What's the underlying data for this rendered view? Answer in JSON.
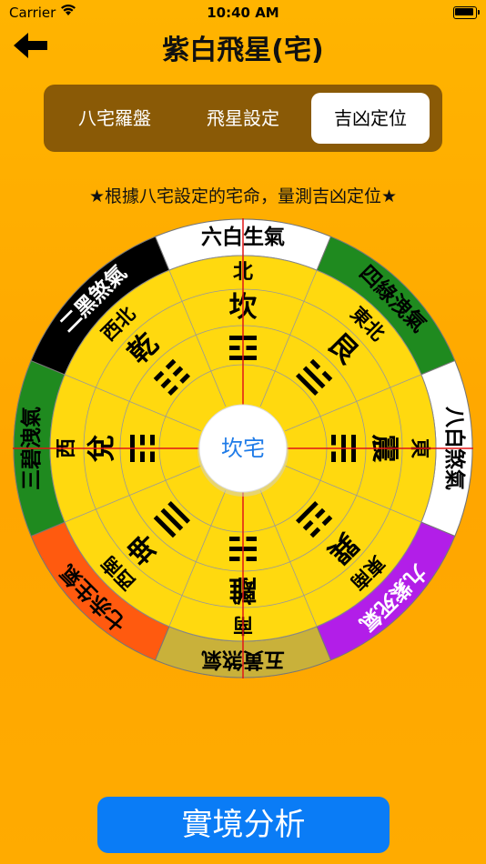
{
  "status_bar": {
    "carrier": "Carrier",
    "time": "10:40 AM"
  },
  "nav": {
    "title": "紫白飛星(宅)",
    "back_icon": "back-arrow-icon"
  },
  "tabs": [
    {
      "label": "八宅羅盤",
      "active": false
    },
    {
      "label": "飛星設定",
      "active": false
    },
    {
      "label": "吉凶定位",
      "active": true
    }
  ],
  "subtitle": "★根據八宅設定的宅命，量測吉凶定位★",
  "compass": {
    "center_label": "坎宅",
    "sectors": [
      {
        "direction": "北",
        "palace": "坎",
        "trigram": [
          0,
          1,
          0
        ],
        "star": "六白生氣",
        "bg": "#ffffff",
        "fg": "#000000"
      },
      {
        "direction": "東北",
        "palace": "艮",
        "trigram": [
          1,
          0,
          0
        ],
        "star": "四綠洩氣",
        "bg": "#1f8a1f",
        "fg": "#000000"
      },
      {
        "direction": "東",
        "palace": "震",
        "trigram": [
          0,
          0,
          1
        ],
        "star": "八白煞氣",
        "bg": "#ffffff",
        "fg": "#000000"
      },
      {
        "direction": "東南",
        "palace": "巽",
        "trigram": [
          1,
          1,
          0
        ],
        "star": "九紫死氣",
        "bg": "#b21ee8",
        "fg": "#ffffff"
      },
      {
        "direction": "南",
        "palace": "離",
        "trigram": [
          1,
          0,
          1
        ],
        "star": "五黃煞氣",
        "bg": "#c9b13a",
        "fg": "#000000"
      },
      {
        "direction": "西南",
        "palace": "坤",
        "trigram": [
          0,
          0,
          0
        ],
        "star": "七赤生氣",
        "bg": "#ff5a0f",
        "fg": "#000000"
      },
      {
        "direction": "西",
        "palace": "兌",
        "trigram": [
          0,
          1,
          1
        ],
        "star": "三碧洩氣",
        "bg": "#1f8a1f",
        "fg": "#000000"
      },
      {
        "direction": "西北",
        "palace": "乾",
        "trigram": [
          1,
          1,
          1
        ],
        "star": "二黑煞氣",
        "bg": "#000000",
        "fg": "#ffffff"
      }
    ],
    "colors": {
      "inner": "#ffd90f",
      "crosshair": "#e21616",
      "center_text": "#1e7be8"
    }
  },
  "action": {
    "label": "實境分析"
  }
}
